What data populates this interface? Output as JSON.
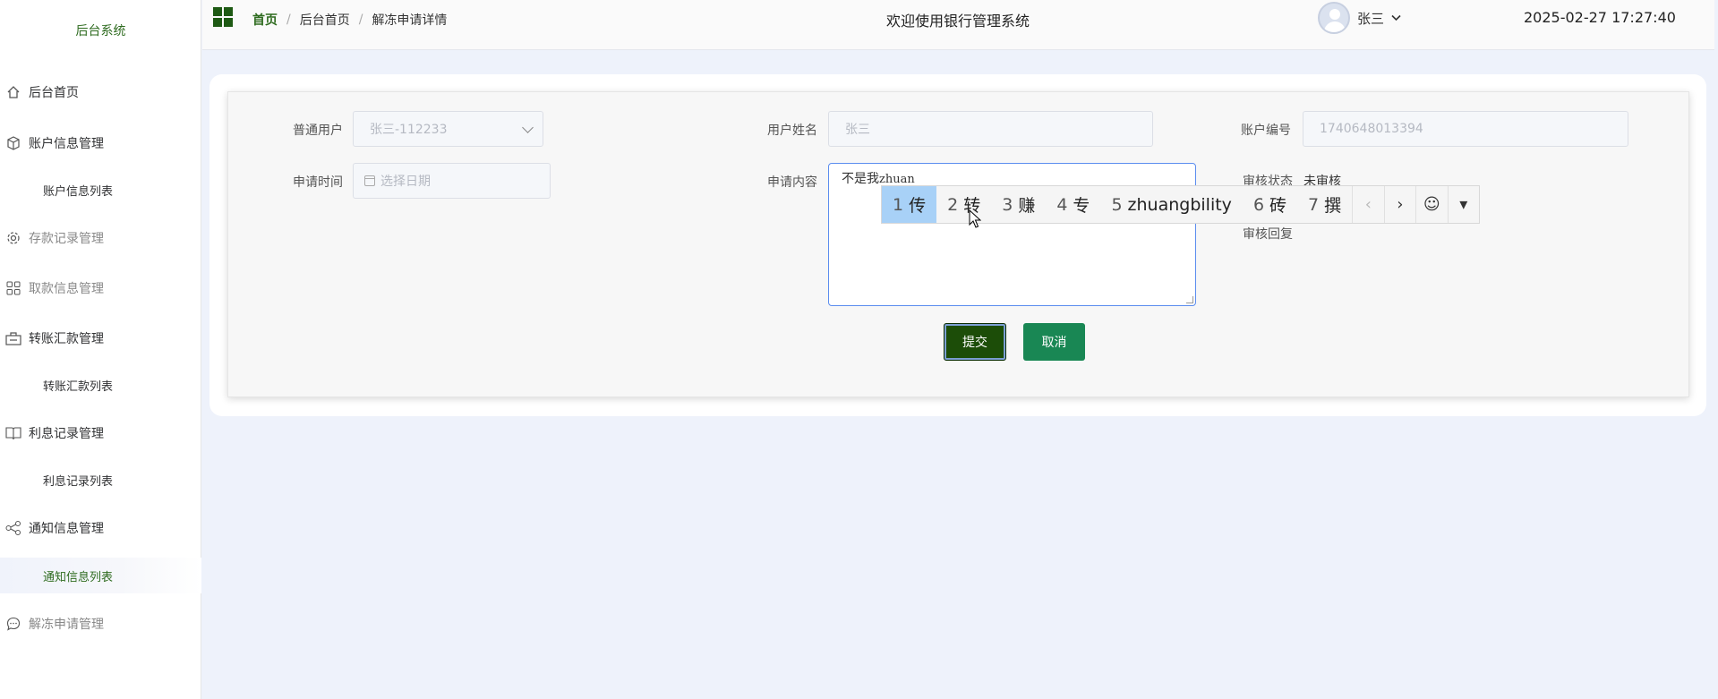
{
  "sidebar": {
    "brand": "后台系统",
    "items": [
      {
        "label": "后台首页"
      },
      {
        "label": "账户信息管理"
      },
      {
        "label": "账户信息列表"
      },
      {
        "label": "存款记录管理"
      },
      {
        "label": "取款信息管理"
      },
      {
        "label": "转账汇款管理"
      },
      {
        "label": "转账汇款列表"
      },
      {
        "label": "利息记录管理"
      },
      {
        "label": "利息记录列表"
      },
      {
        "label": "通知信息管理"
      },
      {
        "label": "通知信息列表"
      },
      {
        "label": "解冻申请管理"
      }
    ]
  },
  "header": {
    "breadcrumb": [
      "首页",
      "后台首页",
      "解冻申请详情"
    ],
    "breadcrumb_sep": "/",
    "welcome": "欢迎使用银行管理系统",
    "user_name": "张三",
    "datetime": "2025-02-27 17:27:40"
  },
  "form": {
    "user_label": "普通用户",
    "user_value": "张三-112233",
    "name_label": "用户姓名",
    "name_value": "张三",
    "account_label": "账户编号",
    "account_value": "1740648013394",
    "time_label": "申请时间",
    "time_placeholder": "选择日期",
    "content_label": "申请内容",
    "content_text": "不是我",
    "content_composing": "zhuan",
    "status_label": "审核状态",
    "status_value": "未审核",
    "reply_label": "审核回复",
    "submit_label": "提交",
    "cancel_label": "取消"
  },
  "ime": {
    "candidates": [
      {
        "num": "1",
        "text": "传"
      },
      {
        "num": "2",
        "text": "转"
      },
      {
        "num": "3",
        "text": "赚"
      },
      {
        "num": "4",
        "text": "专"
      },
      {
        "num": "5",
        "text": "zhuangbility"
      },
      {
        "num": "6",
        "text": "砖"
      },
      {
        "num": "7",
        "text": "撰"
      }
    ]
  },
  "colors": {
    "brand": "#2e6b1f",
    "submit": "#1c4d08",
    "cancel": "#198754",
    "ime_selected": "#a8d1f7"
  }
}
